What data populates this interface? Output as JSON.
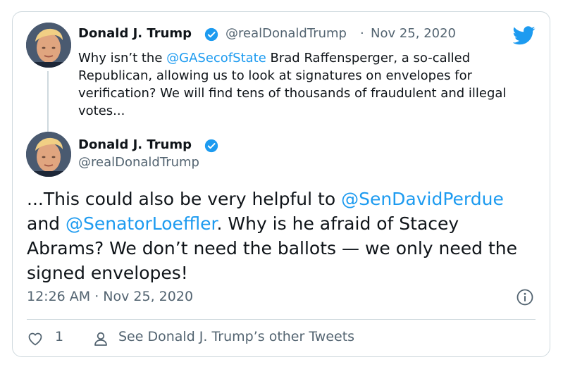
{
  "tweet1": {
    "name": "Donald J. Trump",
    "handle": "@realDonaldTrump",
    "separator": "·",
    "date": "Nov 25, 2020",
    "text_parts": {
      "a": "Why isn’t the ",
      "mention": "@GASecofState",
      "b": " Brad Raffensperger, a so-called Republican, allowing us to look at signatures on envelopes for verification? We will find tens of thousands of fraudulent and illegal votes..."
    }
  },
  "tweet2": {
    "name": "Donald J. Trump",
    "handle": "@realDonaldTrump",
    "text_parts": {
      "a": "...This could also be very helpful to ",
      "mention1": "@SenDavidPerdue",
      "b": " and ",
      "mention2": "@SenatorLoeffler",
      "c": ". Why is he afraid of Stacey Abrams? We don’t need the ballots — we only need the signed envelopes!"
    },
    "timestamp": "12:26 AM · Nov 25, 2020"
  },
  "actions": {
    "like_count": "1",
    "profile_link": "See Donald J. Trump’s other Tweets"
  },
  "colors": {
    "accent": "#1d9bf0",
    "text": "#0f1419",
    "secondary": "#536471",
    "border": "#cfd9de"
  },
  "icons": [
    "twitter-bird-icon",
    "verified-badge-icon",
    "info-icon",
    "heart-icon",
    "person-icon"
  ]
}
